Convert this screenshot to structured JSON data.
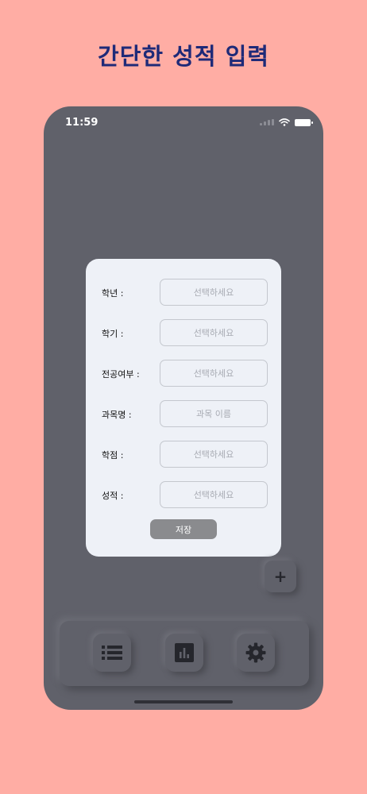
{
  "headline": "간단한 성적 입력",
  "status_bar": {
    "time": "11:59"
  },
  "form": {
    "rows": [
      {
        "label": "학년 :",
        "placeholder": "선택하세요"
      },
      {
        "label": "학기 :",
        "placeholder": "선택하세요"
      },
      {
        "label": "전공여부 :",
        "placeholder": "선택하세요"
      },
      {
        "label": "과목명 :",
        "placeholder": "과목 이름"
      },
      {
        "label": "학점 :",
        "placeholder": "선택하세요"
      },
      {
        "label": "성적 :",
        "placeholder": "선택하세요"
      }
    ],
    "save_label": "저장"
  },
  "fab": {
    "icon": "plus-icon",
    "label": "+"
  },
  "tabbar": {
    "items": [
      {
        "icon": "list-icon"
      },
      {
        "icon": "bar-chart-icon"
      },
      {
        "icon": "gear-icon"
      }
    ]
  },
  "colors": {
    "background": "#FFADA4",
    "headline": "#1E2A78",
    "screen": "#60616A",
    "modal": "#EEF1F7",
    "button": "#8A8B8E"
  }
}
